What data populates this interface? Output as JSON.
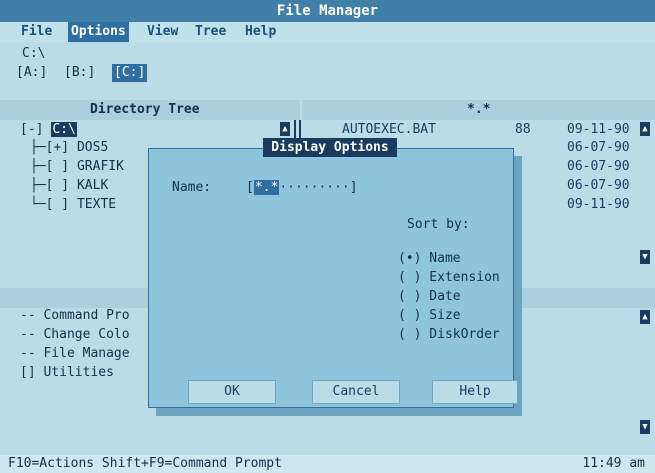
{
  "window": {
    "title": "File Manager"
  },
  "menu": {
    "items": [
      "File",
      "Options",
      "View",
      "Tree",
      "Help"
    ],
    "active_index": 1
  },
  "current_path": "C:\\",
  "drives": [
    {
      "label": "[A:]",
      "selected": false
    },
    {
      "label": "[B:]",
      "selected": false
    },
    {
      "label": "[C:]",
      "selected": true
    }
  ],
  "directory_tree": {
    "header": "Directory Tree",
    "root_prefix": "[-] ",
    "root": "C:\\",
    "items": [
      {
        "prefix": "├─[+] ",
        "name": "DOS5"
      },
      {
        "prefix": "├─[ ] ",
        "name": "GRAFIK"
      },
      {
        "prefix": "├─[ ] ",
        "name": "KALK"
      },
      {
        "prefix": "└─[ ] ",
        "name": "TEXTE"
      }
    ]
  },
  "file_list": {
    "header": "*.*",
    "files": [
      {
        "name": "AUTOEXEC.BAT",
        "size": "88",
        "date": "09-11-90"
      }
    ],
    "dates": [
      "06-07-90",
      "06-07-90",
      "06-07-90",
      "09-11-90"
    ]
  },
  "programs": {
    "items": [
      "-- Command Pro",
      "-- Change Colo",
      "-- File Manage",
      "[] Utilities"
    ]
  },
  "dialog": {
    "title": "Display Options",
    "name_label": "Name:",
    "name_open": "[",
    "name_value": "*.*",
    "name_fill": "·········",
    "name_close": "]",
    "sort_label": "Sort by:",
    "sort_options": [
      {
        "label": "(•) Name"
      },
      {
        "label": "( ) Extension"
      },
      {
        "label": "( ) Date"
      },
      {
        "label": "( ) Size"
      },
      {
        "label": "( ) DiskOrder"
      }
    ],
    "buttons": {
      "ok": "OK",
      "cancel": "Cancel",
      "help": "Help"
    }
  },
  "status_bar": {
    "shortcuts": "F10=Actions  Shift+F9=Command Prompt",
    "time": "11:49 am"
  },
  "icons": {
    "scroll_up": "▲",
    "scroll_down": "▼"
  }
}
